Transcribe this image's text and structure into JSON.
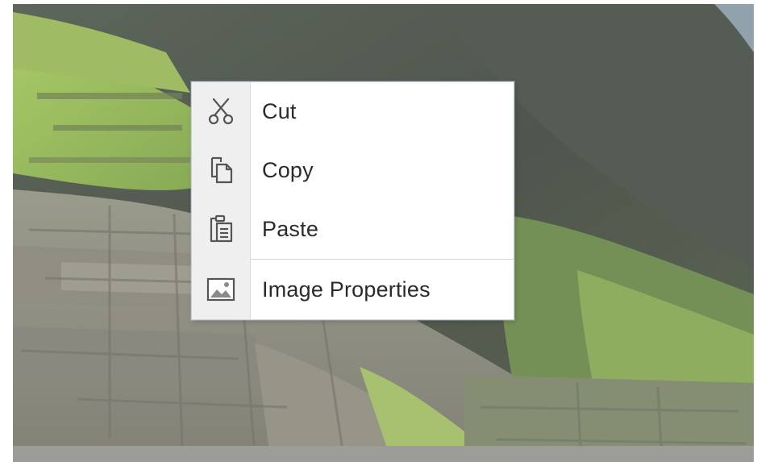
{
  "context_menu": {
    "items": [
      {
        "label": "Cut",
        "icon": "scissors-icon"
      },
      {
        "label": "Copy",
        "icon": "copy-icon"
      },
      {
        "label": "Paste",
        "icon": "paste-icon"
      },
      {
        "label": "Image Properties",
        "icon": "image-icon"
      }
    ]
  },
  "colors": {
    "menu_background": "#ffffff",
    "gutter_background": "#efefef",
    "menu_border": "#c9d1dc",
    "label_text": "#2b2b2b",
    "icon_stroke": "#555555"
  }
}
